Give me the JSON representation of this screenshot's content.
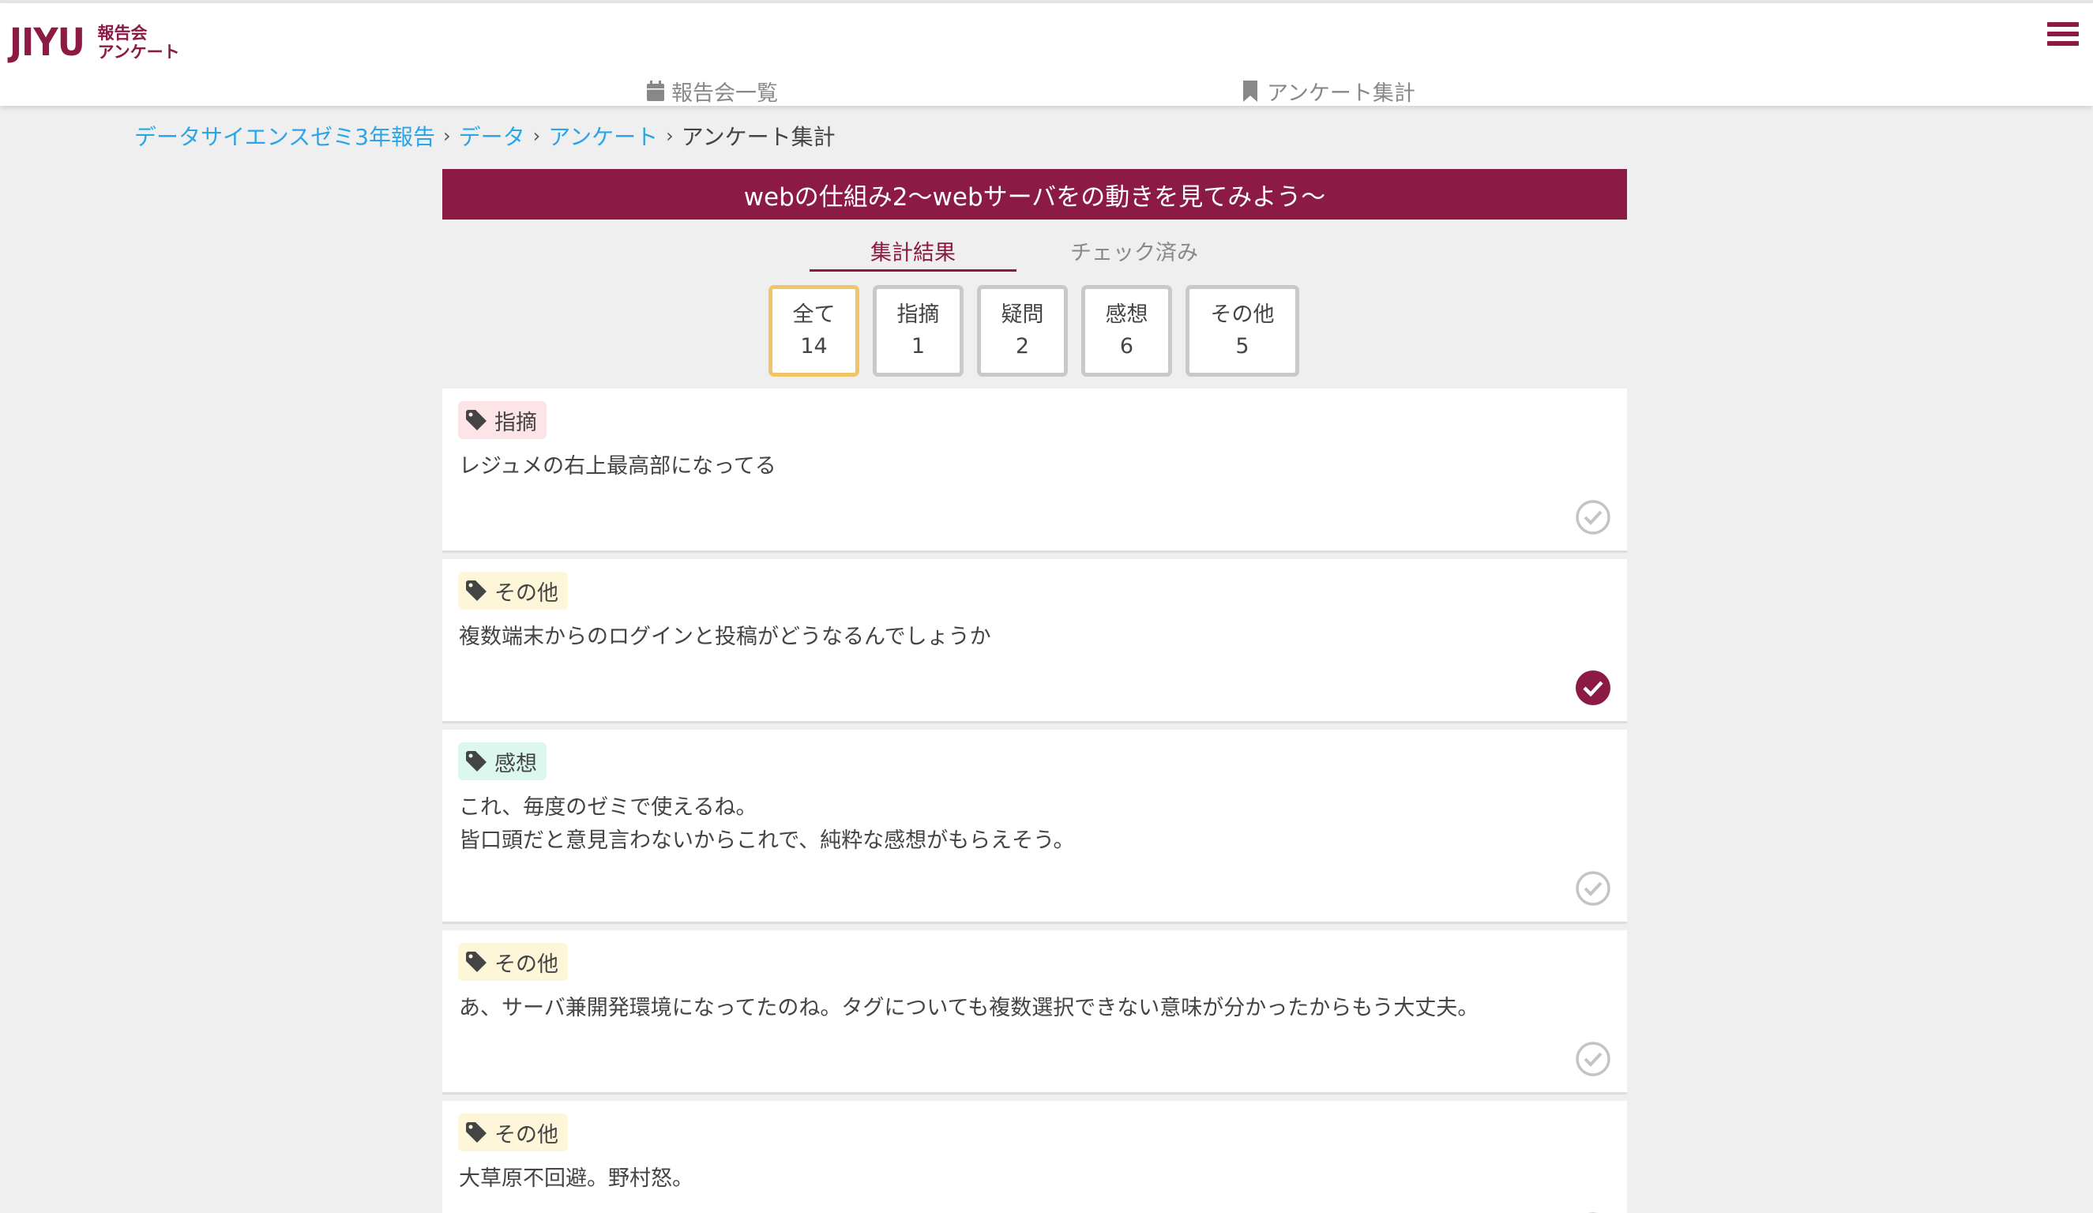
{
  "header": {
    "logo_text": "JIYU",
    "logo_sub_line1": "報告会",
    "logo_sub_line2": "アンケート",
    "menu_icon": "hamburger-menu-icon",
    "nav": [
      {
        "label": "報告会一覧",
        "icon": "calendar-icon"
      },
      {
        "label": "アンケート集計",
        "icon": "bookmark-icon"
      }
    ]
  },
  "breadcrumb": {
    "items": [
      "データサイエンスゼミ3年報告",
      "データ",
      "アンケート"
    ],
    "separator": "›",
    "current": "アンケート集計"
  },
  "page_title": "webの仕組み2〜webサーバをの動きを見てみよう〜",
  "tabs": [
    {
      "label": "集計結果",
      "active": true
    },
    {
      "label": "チェック済み",
      "active": false
    }
  ],
  "filters": [
    {
      "label": "全て",
      "count": "14",
      "active": true
    },
    {
      "label": "指摘",
      "count": "1",
      "active": false
    },
    {
      "label": "疑問",
      "count": "2",
      "active": false
    },
    {
      "label": "感想",
      "count": "6",
      "active": false
    },
    {
      "label": "その他",
      "count": "5",
      "active": false
    }
  ],
  "cards": [
    {
      "tag": "指摘",
      "text_lines": [
        "レジュメの右上最高部になってる"
      ],
      "checked": false
    },
    {
      "tag": "その他",
      "text_lines": [
        "複数端末からのログインと投稿がどうなるんでしょうか"
      ],
      "checked": true
    },
    {
      "tag": "感想",
      "text_lines": [
        "これ、毎度のゼミで使えるね。",
        "皆口頭だと意見言わないからこれで、純粋な感想がもらえそう。"
      ],
      "checked": false
    },
    {
      "tag": "その他",
      "text_lines": [
        "あ、サーバ兼開発環境になってたのね。タグについても複数選択できない意味が分かったからもう大丈夫。"
      ],
      "checked": false
    },
    {
      "tag": "その他",
      "text_lines": [
        "大草原不回避。野村怒。"
      ],
      "checked": false
    }
  ],
  "colors": {
    "brand": "#8b1a45",
    "link": "#2aa6e8",
    "tag_pink": "#fde4e6",
    "tag_yellow": "#fdf6d9",
    "tag_green": "#dcf7ee",
    "active_filter_border": "#f0c469"
  }
}
